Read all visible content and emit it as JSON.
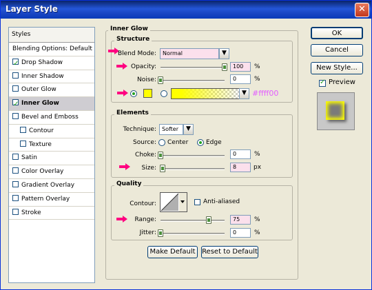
{
  "window": {
    "title": "Layer Style",
    "close_glyph": "✕"
  },
  "styles_panel": {
    "header": "Styles",
    "items": [
      {
        "label": "Blending Options: Default",
        "checkbox": false
      },
      {
        "label": "Drop Shadow",
        "checkbox": true,
        "checked": true
      },
      {
        "label": "Inner Shadow",
        "checkbox": true,
        "checked": false
      },
      {
        "label": "Outer Glow",
        "checkbox": true,
        "checked": false
      },
      {
        "label": "Inner Glow",
        "checkbox": true,
        "checked": true,
        "selected": true
      },
      {
        "label": "Bevel and Emboss",
        "checkbox": true,
        "checked": false
      },
      {
        "label": "Contour",
        "checkbox": true,
        "checked": false,
        "sub": true
      },
      {
        "label": "Texture",
        "checkbox": true,
        "checked": false,
        "sub": true
      },
      {
        "label": "Satin",
        "checkbox": true,
        "checked": false
      },
      {
        "label": "Color Overlay",
        "checkbox": true,
        "checked": false
      },
      {
        "label": "Gradient Overlay",
        "checkbox": true,
        "checked": false
      },
      {
        "label": "Pattern Overlay",
        "checkbox": true,
        "checked": false
      },
      {
        "label": "Stroke",
        "checkbox": true,
        "checked": false
      }
    ]
  },
  "inner_glow": {
    "title": "Inner Glow",
    "structure": {
      "title": "Structure",
      "blend_mode_label": "Blend Mode:",
      "blend_mode_value": "Normal",
      "opacity_label": "Opacity:",
      "opacity_value": "100",
      "opacity_level": 1.0,
      "noise_label": "Noise:",
      "noise_value": "0",
      "noise_level": 0.0,
      "percent": "%",
      "glow_color": "#ffff00",
      "color_label": "#ffff00"
    },
    "elements": {
      "title": "Elements",
      "technique_label": "Technique:",
      "technique_value": "Softer",
      "source_label": "Source:",
      "source_center": "Center",
      "source_edge": "Edge",
      "choke_label": "Choke:",
      "choke_value": "0",
      "choke_level": 0.0,
      "size_label": "Size:",
      "size_value": "8",
      "size_level": 0.03,
      "percent": "%",
      "px": "px"
    },
    "quality": {
      "title": "Quality",
      "contour_label": "Contour:",
      "anti_aliased_label": "Anti-aliased",
      "range_label": "Range:",
      "range_value": "75",
      "range_level": 0.75,
      "jitter_label": "Jitter:",
      "jitter_value": "0",
      "jitter_level": 0.0,
      "percent": "%"
    },
    "make_default": "Make Default",
    "reset_default": "Reset to Default"
  },
  "actions": {
    "ok": "OK",
    "cancel": "Cancel",
    "new_style": "New Style...",
    "preview_label": "Preview",
    "preview_checked": true
  },
  "colors": {
    "highlight_pink": "#fbe0ec",
    "arrow_magenta": "#ff0080",
    "glow_yellow": "#ffff00"
  }
}
